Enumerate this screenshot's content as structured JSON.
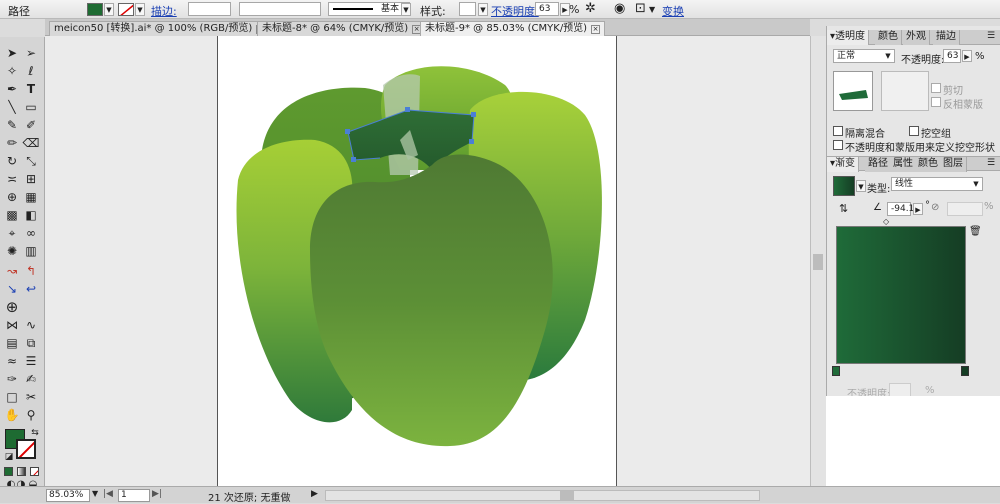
{
  "control_bar": {
    "object_type": "路径",
    "stroke_label": "描边:",
    "stroke_profile": "基本",
    "style_label": "样式:",
    "opacity_label": "不透明度:",
    "opacity_value": "63",
    "percent": "%",
    "transform_link": "变换",
    "fill_color": "#1e6b32"
  },
  "tabs": [
    {
      "label": "meicon50 [转换].ai* @ 100% (RGB/预览)"
    },
    {
      "label": "未标题-8* @ 64% (CMYK/预览)"
    },
    {
      "label": "未标题-9* @ 85.03% (CMYK/预览)"
    }
  ],
  "tools": {
    "fill_color": "#1e6b32"
  },
  "transparency_panel": {
    "tab_title": "透明度",
    "tabs": [
      "颜色",
      "外观",
      "描边"
    ],
    "blend_mode": "正常",
    "opacity_label": "不透明度:",
    "opacity_value": "63",
    "percent": "%",
    "clip_label": "剪切",
    "invert_mask_label": "反相蒙版",
    "isolate_blending_label": "隔离混合",
    "knockout_group_label": "挖空组",
    "opacity_mask_label": "不透明度和蒙版用来定义挖空形状"
  },
  "gradient_panel": {
    "tabs": [
      "渐变",
      "路径",
      "属性",
      "颜色",
      "图层"
    ],
    "type_label": "类型:",
    "type_value": "线性",
    "angle_value": "-94.1",
    "degree": "°",
    "opacity_label": "不透明度:",
    "percent": "%",
    "color_start": "#1f6b39",
    "color_end": "#153d24"
  },
  "status_bar": {
    "zoom": "85.03%",
    "artboard": "1",
    "history": "21 次还原; 无重做"
  }
}
